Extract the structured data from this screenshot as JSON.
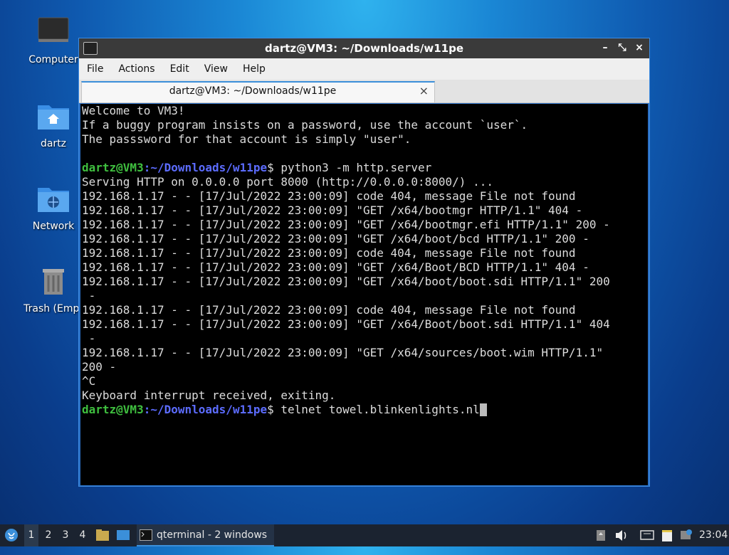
{
  "desktop": {
    "icons": [
      {
        "label": "Computer"
      },
      {
        "label": "dartz"
      },
      {
        "label": "Network"
      },
      {
        "label": "Trash (Empt"
      }
    ]
  },
  "window": {
    "title": "dartz@VM3: ~/Downloads/w11pe",
    "controls": {
      "minimize": "–",
      "restore": "⤡",
      "close": "×"
    },
    "menu": [
      "File",
      "Actions",
      "Edit",
      "View",
      "Help"
    ],
    "tab": {
      "label": "dartz@VM3: ~/Downloads/w11pe",
      "close": "×"
    }
  },
  "terminal": {
    "prompt_user": "dartz@VM3",
    "prompt_sep": ":",
    "prompt_path": "~/Downloads/w11pe",
    "prompt_end": "$",
    "lines": {
      "l0": "Welcome to VM3!",
      "l1": "If a buggy program insists on a password, use the account `user`.",
      "l2": "The passsword for that account is simply \"user\".",
      "l3": "",
      "cmd1": " python3 -m http.server",
      "l5": "Serving HTTP on 0.0.0.0 port 8000 (http://0.0.0.0:8000/) ...",
      "l6": "192.168.1.17 - - [17/Jul/2022 23:00:09] code 404, message File not found",
      "l7": "192.168.1.17 - - [17/Jul/2022 23:00:09] \"GET /x64/bootmgr HTTP/1.1\" 404 -",
      "l8": "192.168.1.17 - - [17/Jul/2022 23:00:09] \"GET /x64/bootmgr.efi HTTP/1.1\" 200 -",
      "l9": "192.168.1.17 - - [17/Jul/2022 23:00:09] \"GET /x64/boot/bcd HTTP/1.1\" 200 -",
      "l10": "192.168.1.17 - - [17/Jul/2022 23:00:09] code 404, message File not found",
      "l11": "192.168.1.17 - - [17/Jul/2022 23:00:09] \"GET /x64/Boot/BCD HTTP/1.1\" 404 -",
      "l12": "192.168.1.17 - - [17/Jul/2022 23:00:09] \"GET /x64/boot/boot.sdi HTTP/1.1\" 200",
      "l13": " -",
      "l14": "192.168.1.17 - - [17/Jul/2022 23:00:09] code 404, message File not found",
      "l15": "192.168.1.17 - - [17/Jul/2022 23:00:09] \"GET /x64/Boot/boot.sdi HTTP/1.1\" 404",
      "l16": " -",
      "l17": "192.168.1.17 - - [17/Jul/2022 23:00:09] \"GET /x64/sources/boot.wim HTTP/1.1\"",
      "l18": "200 -",
      "l19": "^C",
      "l20": "Keyboard interrupt received, exiting.",
      "cmd2": " telnet towel.blinkenlights.nl"
    }
  },
  "taskbar": {
    "workspaces": [
      "1",
      "2",
      "3",
      "4"
    ],
    "task_label": "qterminal - 2 windows",
    "clock": "23:04"
  },
  "colors": {
    "prompt_user": "#3fbf3f",
    "prompt_path": "#5c6cff",
    "accent": "#3b8fd9"
  }
}
